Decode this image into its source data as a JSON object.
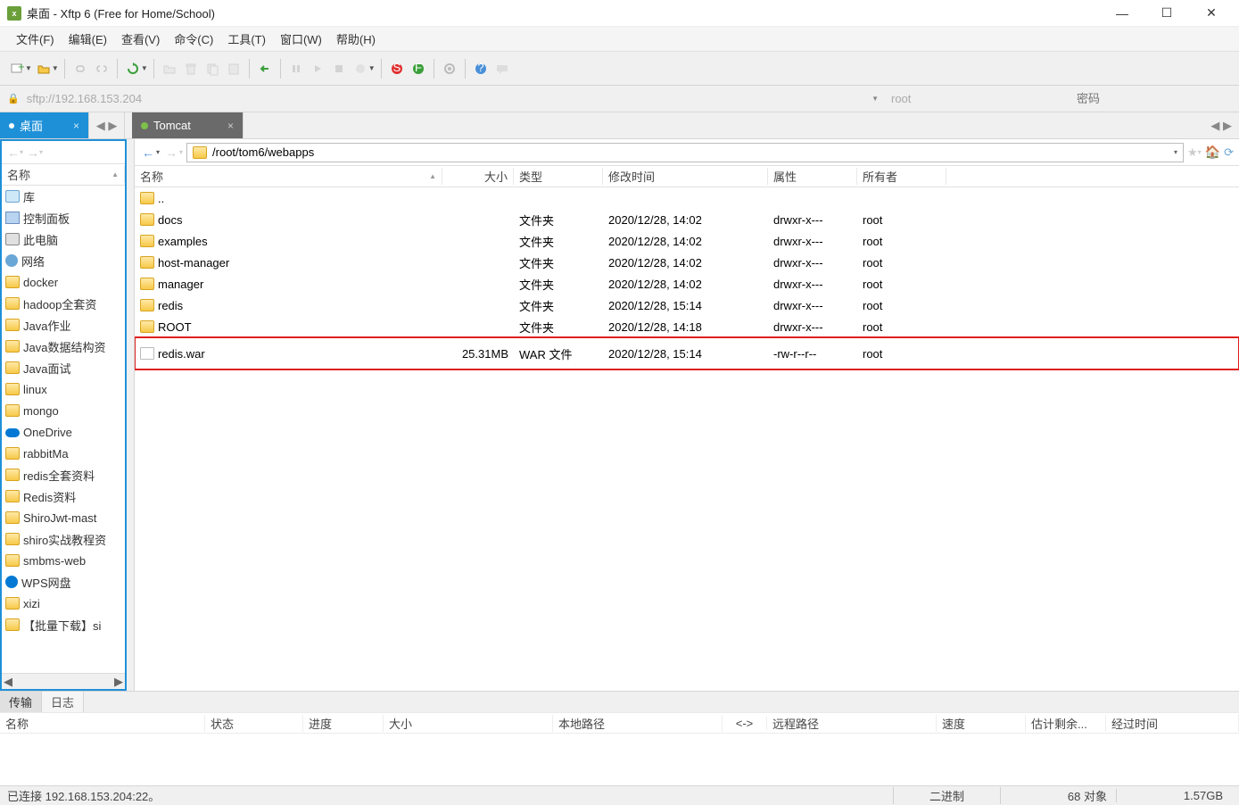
{
  "title": "桌面 - Xftp 6 (Free for Home/School)",
  "menu": {
    "file": "文件(F)",
    "edit": "编辑(E)",
    "view": "查看(V)",
    "cmd": "命令(C)",
    "tool": "工具(T)",
    "window": "窗口(W)",
    "help": "帮助(H)"
  },
  "address": {
    "url": "sftp://192.168.153.204",
    "user": "root",
    "pass_placeholder": "密码"
  },
  "tabs": {
    "local": "桌面",
    "remote": "Tomcat"
  },
  "local": {
    "name_col": "名称",
    "items": [
      {
        "label": "库",
        "icon": "lib"
      },
      {
        "label": "控制面板",
        "icon": "panel"
      },
      {
        "label": "此电脑",
        "icon": "pc"
      },
      {
        "label": "网络",
        "icon": "net"
      },
      {
        "label": "docker",
        "icon": "folder"
      },
      {
        "label": "hadoop全套资",
        "icon": "folder"
      },
      {
        "label": "Java作业",
        "icon": "folder"
      },
      {
        "label": "Java数据结构资",
        "icon": "folder"
      },
      {
        "label": "Java面试",
        "icon": "folder"
      },
      {
        "label": "linux",
        "icon": "folder"
      },
      {
        "label": "mongo",
        "icon": "folder"
      },
      {
        "label": "OneDrive",
        "icon": "cloud"
      },
      {
        "label": "rabbitMa",
        "icon": "folder"
      },
      {
        "label": "redis全套资料",
        "icon": "folder"
      },
      {
        "label": "Redis资料",
        "icon": "folder"
      },
      {
        "label": "ShiroJwt-mast",
        "icon": "folder"
      },
      {
        "label": "shiro实战教程资",
        "icon": "folder"
      },
      {
        "label": "smbms-web",
        "icon": "folder"
      },
      {
        "label": "WPS网盘",
        "icon": "wps"
      },
      {
        "label": "xizi",
        "icon": "folder"
      },
      {
        "label": "【批量下载】si",
        "icon": "folder"
      }
    ]
  },
  "remote": {
    "path": "/root/tom6/webapps",
    "cols": {
      "name": "名称",
      "size": "大小",
      "type": "类型",
      "mtime": "修改时间",
      "attr": "属性",
      "owner": "所有者"
    },
    "rows": [
      {
        "name": "..",
        "size": "",
        "type": "",
        "mtime": "",
        "attr": "",
        "owner": "",
        "icon": "folder"
      },
      {
        "name": "docs",
        "size": "",
        "type": "文件夹",
        "mtime": "2020/12/28, 14:02",
        "attr": "drwxr-x---",
        "owner": "root",
        "icon": "folder"
      },
      {
        "name": "examples",
        "size": "",
        "type": "文件夹",
        "mtime": "2020/12/28, 14:02",
        "attr": "drwxr-x---",
        "owner": "root",
        "icon": "folder"
      },
      {
        "name": "host-manager",
        "size": "",
        "type": "文件夹",
        "mtime": "2020/12/28, 14:02",
        "attr": "drwxr-x---",
        "owner": "root",
        "icon": "folder"
      },
      {
        "name": "manager",
        "size": "",
        "type": "文件夹",
        "mtime": "2020/12/28, 14:02",
        "attr": "drwxr-x---",
        "owner": "root",
        "icon": "folder"
      },
      {
        "name": "redis",
        "size": "",
        "type": "文件夹",
        "mtime": "2020/12/28, 15:14",
        "attr": "drwxr-x---",
        "owner": "root",
        "icon": "folder"
      },
      {
        "name": "ROOT",
        "size": "",
        "type": "文件夹",
        "mtime": "2020/12/28, 14:18",
        "attr": "drwxr-x---",
        "owner": "root",
        "icon": "folder"
      },
      {
        "name": "redis.war",
        "size": "25.31MB",
        "type": "WAR 文件",
        "mtime": "2020/12/28, 15:14",
        "attr": "-rw-r--r--",
        "owner": "root",
        "icon": "file",
        "hl": true
      }
    ]
  },
  "bottom_tabs": {
    "transfer": "传输",
    "log": "日志"
  },
  "transfer_cols": {
    "name": "名称",
    "status": "状态",
    "progress": "进度",
    "size": "大小",
    "localpath": "本地路径",
    "dir": "<->",
    "remotepath": "远程路径",
    "speed": "速度",
    "eta": "估计剩余...",
    "elapsed": "经过时间"
  },
  "status": {
    "conn": "已连接 192.168.153.204:22。",
    "mode": "二进制",
    "objs": "68 对象",
    "total": "1.57GB"
  }
}
